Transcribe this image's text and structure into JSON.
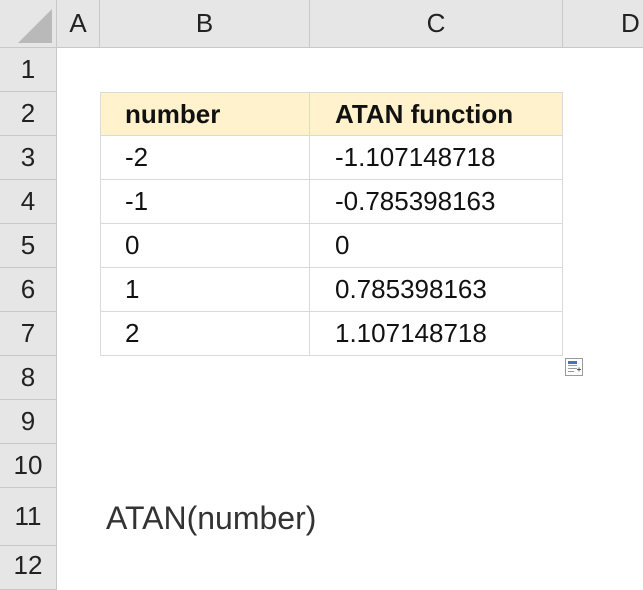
{
  "columns": [
    "A",
    "B",
    "C",
    "D"
  ],
  "rows": [
    "1",
    "2",
    "3",
    "4",
    "5",
    "6",
    "7",
    "8",
    "9",
    "10",
    "11",
    "12"
  ],
  "table": {
    "headers": [
      "number",
      "ATAN function"
    ],
    "rows": [
      [
        "-2",
        "-1.107148718"
      ],
      [
        "-1",
        "-0.785398163"
      ],
      [
        "0",
        "0"
      ],
      [
        "1",
        "0.785398163"
      ],
      [
        "2",
        "1.107148718"
      ]
    ],
    "header_fill": "#fff2cc"
  },
  "syntax_text": "ATAN(number)",
  "quick_analysis_icon": "quick-analysis-icon"
}
